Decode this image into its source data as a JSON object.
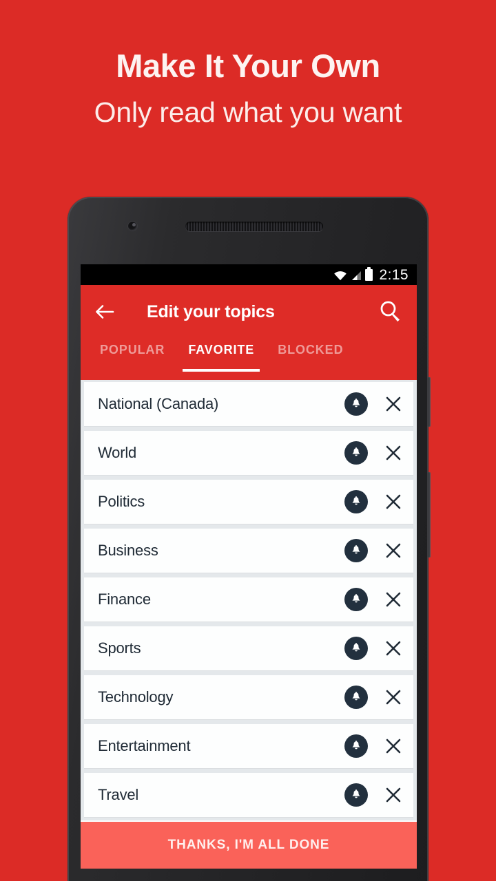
{
  "promo": {
    "title": "Make It Your Own",
    "subtitle": "Only read what you want"
  },
  "colors": {
    "background_red": "#DC2B26",
    "appbar_red": "#DE2C27",
    "cta_coral": "#FA6259",
    "icon_navy": "#22303E",
    "list_gray": "#E4E8EB",
    "card_white": "#FDFEFE"
  },
  "status_bar": {
    "time": "2:15",
    "icons": [
      "wifi-icon",
      "signal-icon",
      "battery-icon"
    ]
  },
  "appbar": {
    "back_icon": "back-arrow-icon",
    "title": "Edit your topics",
    "search_icon": "search-icon"
  },
  "tabs": [
    {
      "label": "POPULAR",
      "active": false
    },
    {
      "label": "FAVORITE",
      "active": true
    },
    {
      "label": "BLOCKED",
      "active": false
    }
  ],
  "topics": [
    {
      "label": "National (Canada)",
      "bell_icon": "bell-icon",
      "close_icon": "close-icon"
    },
    {
      "label": "World",
      "bell_icon": "bell-icon",
      "close_icon": "close-icon"
    },
    {
      "label": "Politics",
      "bell_icon": "bell-icon",
      "close_icon": "close-icon"
    },
    {
      "label": "Business",
      "bell_icon": "bell-icon",
      "close_icon": "close-icon"
    },
    {
      "label": "Finance",
      "bell_icon": "bell-icon",
      "close_icon": "close-icon"
    },
    {
      "label": "Sports",
      "bell_icon": "bell-icon",
      "close_icon": "close-icon"
    },
    {
      "label": "Technology",
      "bell_icon": "bell-icon",
      "close_icon": "close-icon"
    },
    {
      "label": "Entertainment",
      "bell_icon": "bell-icon",
      "close_icon": "close-icon"
    },
    {
      "label": "Travel",
      "bell_icon": "bell-icon",
      "close_icon": "close-icon"
    }
  ],
  "cta": {
    "label": "THANKS, I'M ALL DONE"
  }
}
